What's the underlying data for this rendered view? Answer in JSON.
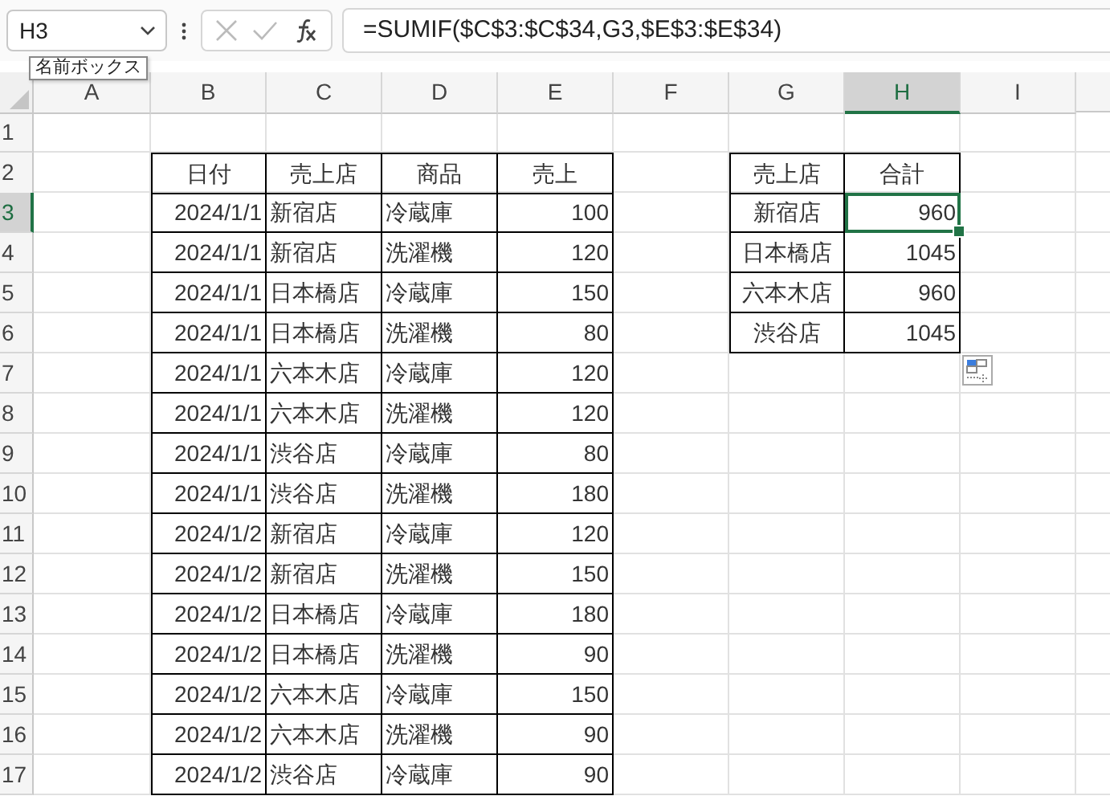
{
  "name_box": {
    "value": "H3",
    "tooltip": "名前ボックス"
  },
  "formula_bar": {
    "value": "=SUMIF($C$3:$C$34,G3,$E$3:$E$34)"
  },
  "column_headers": [
    {
      "label": "A",
      "selected": false
    },
    {
      "label": "B",
      "selected": false
    },
    {
      "label": "C",
      "selected": false
    },
    {
      "label": "D",
      "selected": false
    },
    {
      "label": "E",
      "selected": false
    },
    {
      "label": "F",
      "selected": false
    },
    {
      "label": "G",
      "selected": false
    },
    {
      "label": "H",
      "selected": true
    },
    {
      "label": "I",
      "selected": false
    }
  ],
  "row_headers": [
    {
      "label": "1",
      "selected": false
    },
    {
      "label": "2",
      "selected": false
    },
    {
      "label": "3",
      "selected": true
    },
    {
      "label": "4",
      "selected": false
    },
    {
      "label": "5",
      "selected": false
    },
    {
      "label": "6",
      "selected": false
    },
    {
      "label": "7",
      "selected": false
    },
    {
      "label": "8",
      "selected": false
    },
    {
      "label": "9",
      "selected": false
    },
    {
      "label": "10",
      "selected": false
    },
    {
      "label": "11",
      "selected": false
    },
    {
      "label": "12",
      "selected": false
    },
    {
      "label": "13",
      "selected": false
    },
    {
      "label": "14",
      "selected": false
    },
    {
      "label": "15",
      "selected": false
    },
    {
      "label": "16",
      "selected": false
    },
    {
      "label": "17",
      "selected": false
    }
  ],
  "sales_table": {
    "columns": [
      "日付",
      "売上店",
      "商品",
      "売上"
    ],
    "rows": [
      [
        "2024/1/1",
        "新宿店",
        "冷蔵庫",
        "100"
      ],
      [
        "2024/1/1",
        "新宿店",
        "洗濯機",
        "120"
      ],
      [
        "2024/1/1",
        "日本橋店",
        "冷蔵庫",
        "150"
      ],
      [
        "2024/1/1",
        "日本橋店",
        "洗濯機",
        "80"
      ],
      [
        "2024/1/1",
        "六本木店",
        "冷蔵庫",
        "120"
      ],
      [
        "2024/1/1",
        "六本木店",
        "洗濯機",
        "120"
      ],
      [
        "2024/1/1",
        "渋谷店",
        "冷蔵庫",
        "80"
      ],
      [
        "2024/1/1",
        "渋谷店",
        "洗濯機",
        "180"
      ],
      [
        "2024/1/2",
        "新宿店",
        "冷蔵庫",
        "120"
      ],
      [
        "2024/1/2",
        "新宿店",
        "洗濯機",
        "150"
      ],
      [
        "2024/1/2",
        "日本橋店",
        "冷蔵庫",
        "180"
      ],
      [
        "2024/1/2",
        "日本橋店",
        "洗濯機",
        "90"
      ],
      [
        "2024/1/2",
        "六本木店",
        "冷蔵庫",
        "150"
      ],
      [
        "2024/1/2",
        "六本木店",
        "洗濯機",
        "90"
      ],
      [
        "2024/1/2",
        "渋谷店",
        "冷蔵庫",
        "90"
      ]
    ]
  },
  "summary_table": {
    "columns": [
      "売上店",
      "合計"
    ],
    "rows": [
      {
        "store": "新宿店",
        "total": "960",
        "selected": true
      },
      {
        "store": "日本橋店",
        "total": "1045",
        "selected": false
      },
      {
        "store": "六本木店",
        "total": "960",
        "selected": false
      },
      {
        "store": "渋谷店",
        "total": "1045",
        "selected": false
      }
    ]
  }
}
